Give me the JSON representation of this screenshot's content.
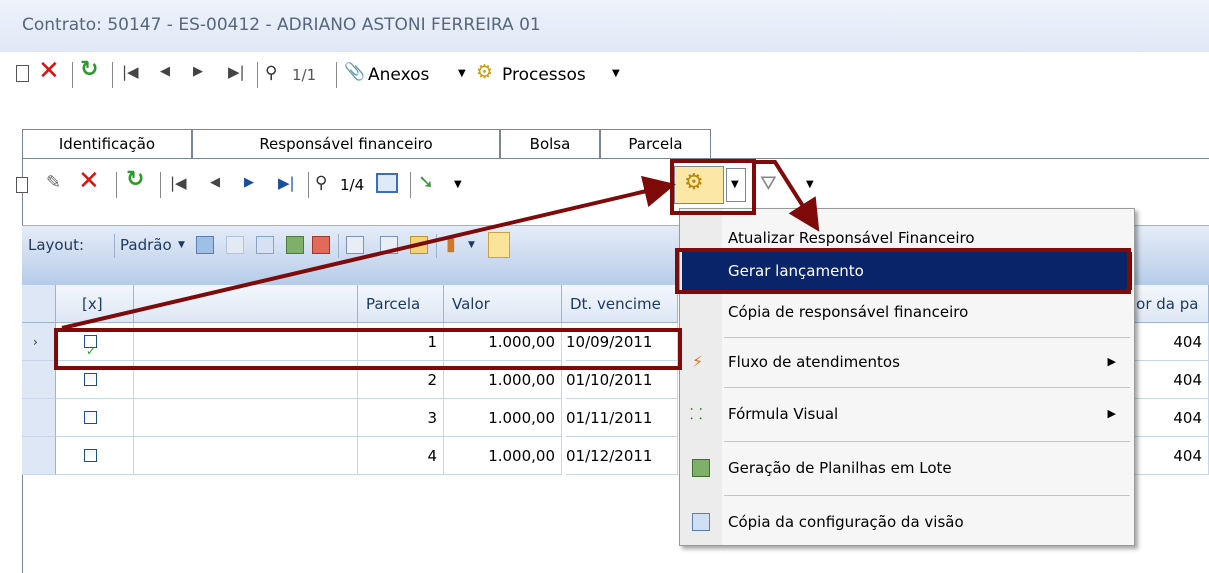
{
  "window": {
    "title": "Contrato: 50147 - ES-00412 - ADRIANO ASTONI FERREIRA 01"
  },
  "toolbar_main": {
    "record_counter": "1/1",
    "anexos_label": "Anexos",
    "processos_label": "Processos"
  },
  "tabs": [
    {
      "label": "Identificação"
    },
    {
      "label": "Responsável financeiro"
    },
    {
      "label": "Bolsa"
    },
    {
      "label": "Parcela"
    }
  ],
  "toolbar_sub": {
    "record_counter": "1/4"
  },
  "layout_bar": {
    "label": "Layout:",
    "preset": "Padrão"
  },
  "grid": {
    "columns": [
      "[x]",
      "",
      "Parcela",
      "Valor",
      "Dt. vencime",
      "lor da pa"
    ],
    "rows": [
      {
        "selected": true,
        "checked": true,
        "parcela": "1",
        "valor": "1.000,00",
        "vencimento": "10/09/2011",
        "extra": "404"
      },
      {
        "selected": false,
        "checked": false,
        "parcela": "2",
        "valor": "1.000,00",
        "vencimento": "01/10/2011",
        "extra": "404"
      },
      {
        "selected": false,
        "checked": false,
        "parcela": "3",
        "valor": "1.000,00",
        "vencimento": "01/11/2011",
        "extra": "404"
      },
      {
        "selected": false,
        "checked": false,
        "parcela": "4",
        "valor": "1.000,00",
        "vencimento": "01/12/2011",
        "extra": "404"
      }
    ]
  },
  "context_menu": {
    "items": [
      {
        "label": "Atualizar Responsável Financeiro"
      },
      {
        "label": "Gerar lançamento"
      },
      {
        "label": "Cópia de responsável financeiro"
      },
      {
        "label": "Fluxo de atendimentos",
        "submenu_glyph": "▶"
      },
      {
        "label": "Fórmula Visual",
        "submenu_glyph": "▶"
      },
      {
        "label": "Geração de Planilhas em Lote"
      },
      {
        "label": "Cópia da configuração da visão"
      }
    ]
  },
  "colors": {
    "annotation": "#7f0a0a",
    "menu_highlight": "#0a246a"
  },
  "icons": [
    "new-icon",
    "delete-icon",
    "refresh-icon",
    "first-record-icon",
    "previous-record-icon",
    "next-record-icon",
    "last-record-icon",
    "find-icon",
    "attachment-icon",
    "process-icon",
    "dropdown-arrow-icon",
    "edit-icon",
    "calendar-icon",
    "filter-icon",
    "chart-icon"
  ]
}
